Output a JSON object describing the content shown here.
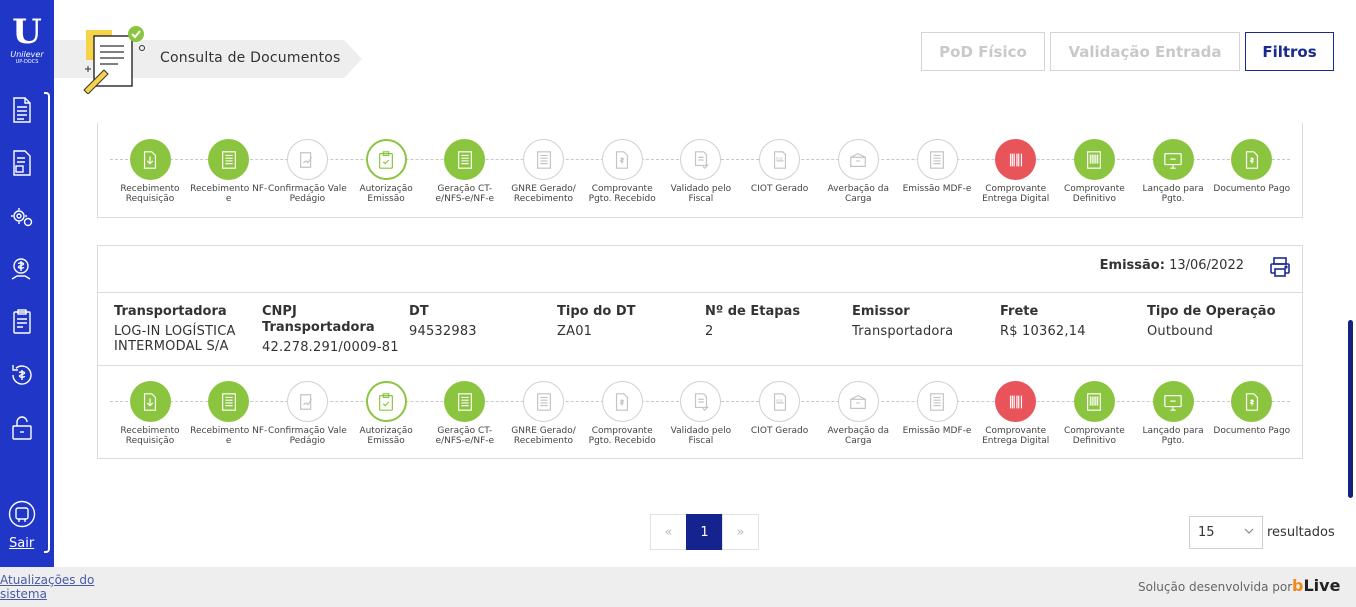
{
  "sidebar": {
    "logo_letter": "U",
    "brand": "Unilever",
    "sub": "UP-DOCS",
    "items": [
      {
        "name": "documents-icon"
      },
      {
        "name": "document-list-icon"
      },
      {
        "name": "settings-gears-icon"
      },
      {
        "name": "money-hand-icon"
      },
      {
        "name": "clipboard-icon"
      },
      {
        "name": "refund-icon"
      },
      {
        "name": "unlock-icon"
      }
    ],
    "logout_label": "Sair"
  },
  "header": {
    "breadcrumb": "Consulta de Documentos",
    "buttons": {
      "pod": "PoD Físico",
      "validacao": "Validação Entrada",
      "filtros": "Filtros"
    }
  },
  "steps": [
    {
      "label": "Recebimento Requisição",
      "status": "done",
      "icon": "download-doc-icon"
    },
    {
      "label": "Recebimento NF-e",
      "status": "done",
      "icon": "invoice-icon"
    },
    {
      "label": "Confirmação Vale Pedágio",
      "status": "pending",
      "icon": "sign-doc-icon"
    },
    {
      "label": "Autorização Emissão",
      "status": "current",
      "icon": "clipboard-check-icon"
    },
    {
      "label": "Geração CT-e/NFS-e/NF-e",
      "status": "done",
      "icon": "invoice-icon"
    },
    {
      "label": "GNRE Gerado/ Recebimento",
      "status": "pending",
      "icon": "invoice-icon"
    },
    {
      "label": "Comprovante Pgto. Recebido",
      "status": "pending",
      "icon": "money-doc-icon"
    },
    {
      "label": "Validado pelo Fiscal",
      "status": "pending",
      "icon": "doc-check-icon"
    },
    {
      "label": "CIOT Gerado",
      "status": "pending",
      "icon": "pdf-icon"
    },
    {
      "label": "Averbação da Carga",
      "status": "pending",
      "icon": "box-icon"
    },
    {
      "label": "Emissão MDF-e",
      "status": "pending",
      "icon": "invoice-icon"
    },
    {
      "label": "Comprovante Entrega Digital",
      "status": "alert",
      "icon": "barcode-icon"
    },
    {
      "label": "Comprovante Definitivo",
      "status": "done",
      "icon": "barcode-doc-icon"
    },
    {
      "label": "Lançado para Pgto.",
      "status": "done",
      "icon": "monitor-icon"
    },
    {
      "label": "Documento Pago",
      "status": "done",
      "icon": "money-doc-icon"
    }
  ],
  "document": {
    "emissao_label": "Emissão:",
    "emissao_value": "13/06/2022",
    "fields": [
      {
        "header": "Transportadora",
        "value": "LOG-IN LOGÍSTICA INTERMODAL S/A"
      },
      {
        "header": "CNPJ Transportadora",
        "value": "42.278.291/0009-81"
      },
      {
        "header": "DT",
        "value": "94532983"
      },
      {
        "header": "Tipo do DT",
        "value": "ZA01"
      },
      {
        "header": "Nº de Etapas",
        "value": "2"
      },
      {
        "header": "Emissor",
        "value": "Transportadora"
      },
      {
        "header": "Frete",
        "value": "R$ 10362,14"
      },
      {
        "header": "Tipo de Operação",
        "value": "Outbound"
      }
    ]
  },
  "pagination": {
    "prev": "«",
    "current": "1",
    "next": "»",
    "per_page": "15",
    "results_label": "resultados"
  },
  "footer": {
    "updates": "Atualizações do sistema",
    "solution": "Solução desenvolvida por",
    "brand_b": "b",
    "brand_live": "Live"
  },
  "colors": {
    "sidebar": "#1f36c7",
    "done": "#8bc53f",
    "alert": "#e8545a",
    "primary": "#1a2b8f"
  }
}
